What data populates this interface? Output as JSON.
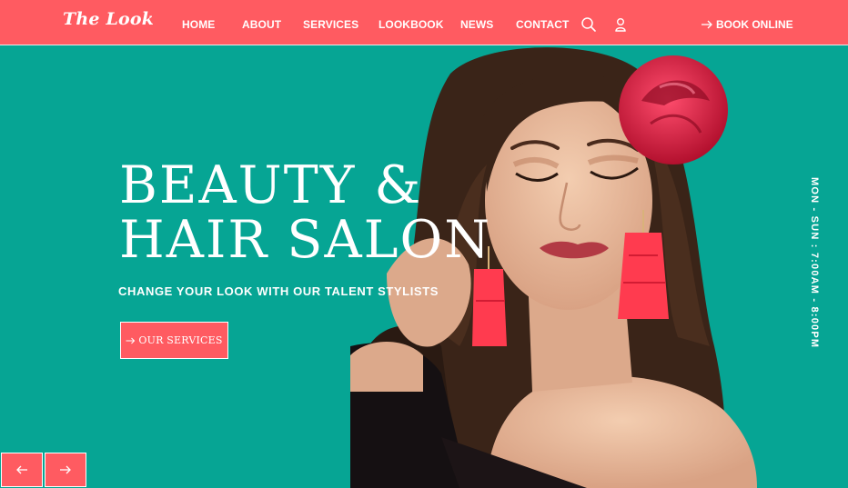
{
  "brand": {
    "logo_text": "The Look"
  },
  "nav": {
    "items": [
      {
        "label": "HOME"
      },
      {
        "label": "ABOUT"
      },
      {
        "label": "SERVICES"
      },
      {
        "label": "LOOKBOOK"
      },
      {
        "label": "NEWS"
      },
      {
        "label": "CONTACT"
      }
    ],
    "icons": [
      "search-icon",
      "user-icon"
    ],
    "book_label": "BOOK ONLINE"
  },
  "hero": {
    "title_line1": "BEAUTY &",
    "title_line2": "HAIR SALON",
    "subtitle": "CHANGE YOUR LOOK WITH OUR TALENT STYLISTS",
    "cta_label": "OUR SERVICES",
    "hours": "MON - SUN : 7:00AM - 8:00PM"
  },
  "slider": {
    "prev_icon": "arrow-left-icon",
    "next_icon": "arrow-right-icon"
  },
  "colors": {
    "accent": "#FF5B61",
    "hero_background": "#06A594",
    "text": "#FFFFFF"
  }
}
